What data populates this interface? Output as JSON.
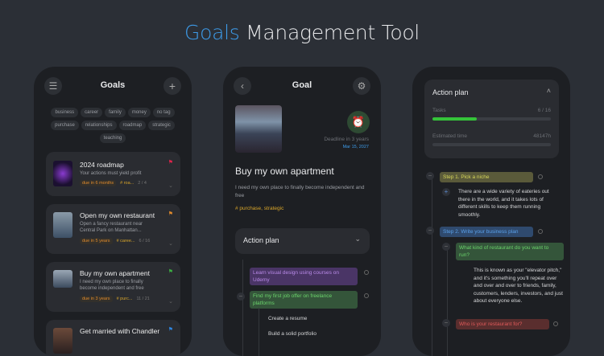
{
  "page_title": {
    "accent": "Goals",
    "rest": " Management Tool"
  },
  "goals_screen": {
    "header": "Goals",
    "menu_icon": "☰",
    "add_icon": "+",
    "tags": [
      "business",
      "career",
      "family",
      "money",
      "no tag",
      "purchase",
      "relationships",
      "roadmap",
      "strategic",
      "teaching"
    ],
    "cards": [
      {
        "title": "2024 roadmap",
        "desc": "Your actions must yield profit",
        "due": "due in 6 months",
        "tag": "# roa...",
        "count": "2 / 4",
        "flag_color": "#e0244b"
      },
      {
        "title": "Open my own restaurant",
        "desc": "Open a fancy restaurant near Central Park on Manhattan...",
        "due": "due in 5 years",
        "tag": "# caree...",
        "count": "6 / 16",
        "flag_color": "#e08a2c"
      },
      {
        "title": "Buy my own apartment",
        "desc": "I need my own place to finally become independent and free",
        "due": "due in 3 years",
        "tag": "# purc...",
        "count": "11 / 21",
        "flag_color": "#3cb043"
      },
      {
        "title": "Get married with Chandler",
        "flag_color": "#2f86e0"
      }
    ]
  },
  "goal_screen": {
    "header": "Goal",
    "deadline_label": "Deadline in 3 years",
    "deadline_date": "Mar 15, 2027",
    "title": "Buy my own apartment",
    "desc": "I need my own place to finally become independent and free",
    "tags": "# purchase, strategic",
    "action_plan": "Action plan",
    "items": [
      "Learn visual design using courses on Udemy",
      "Find my first job offer on freelance platforms",
      "Create a resume",
      "Build a solid portfolio"
    ]
  },
  "plan_screen": {
    "header": "Action plan",
    "tasks_label": "Tasks",
    "tasks_count": "6 / 16",
    "tasks_progress": 0.375,
    "time_label": "Estimated time",
    "time_value": "48147h",
    "step1": "Step 1. Pick a niche",
    "step1_text": "There are a wide variety of eateries out there in the world, and it takes lots of different skills to keep them running smoothly.",
    "step2": "Step 2. Write your business plan",
    "q1": "What kind of restaurant do you want to run?",
    "q1_text": "This is known as your \"elevator pitch,\" and it's something you'll repeat over and over and over to friends, family, customers, lenders, investors, and just about everyone else.",
    "q2": "Who is your restaurant for?"
  }
}
